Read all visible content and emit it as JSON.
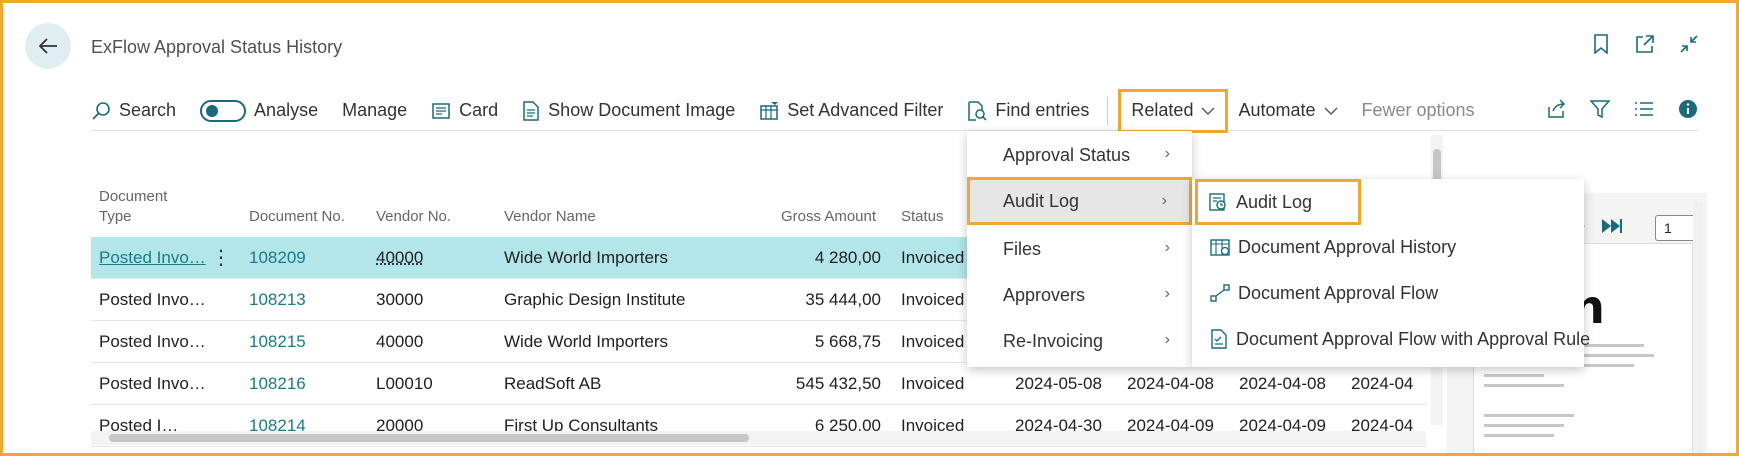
{
  "header": {
    "title": "ExFlow Approval Status History"
  },
  "actions": {
    "search": "Search",
    "analyse": "Analyse",
    "manage": "Manage",
    "card": "Card",
    "show_document_image": "Show Document Image",
    "set_advanced_filter": "Set Advanced Filter",
    "find_entries": "Find entries",
    "related": "Related",
    "automate": "Automate",
    "fewer_options": "Fewer options"
  },
  "table": {
    "headers": {
      "document_type_1": "Document",
      "document_type_2": "Type",
      "document_no": "Document No.",
      "vendor_no": "Vendor No.",
      "vendor_name": "Vendor Name",
      "gross_amount": "Gross Amount",
      "status": "Status"
    },
    "rows": [
      {
        "doc_type": "Posted Invo…",
        "doc_no": "108209",
        "vendor_no": "40000",
        "vendor_name": "Wide World Importers",
        "gross": "4 280,00",
        "status": "Invoiced",
        "d1": "",
        "d2": "",
        "d3": "",
        "d4": ""
      },
      {
        "doc_type": "Posted Invo…",
        "doc_no": "108213",
        "vendor_no": "30000",
        "vendor_name": "Graphic Design Institute",
        "gross": "35 444,00",
        "status": "Invoiced",
        "d1": "",
        "d2": "",
        "d3": "",
        "d4": ""
      },
      {
        "doc_type": "Posted Invo…",
        "doc_no": "108215",
        "vendor_no": "40000",
        "vendor_name": "Wide World Importers",
        "gross": "5 668,75",
        "status": "Invoiced",
        "d1": "",
        "d2": "",
        "d3": "",
        "d4": ""
      },
      {
        "doc_type": "Posted Invo…",
        "doc_no": "108216",
        "vendor_no": "L00010",
        "vendor_name": "ReadSoft AB",
        "gross": "545 432,50",
        "status": "Invoiced",
        "d1": "2024-05-08",
        "d2": "2024-04-08",
        "d3": "2024-04-08",
        "d4": "2024-04"
      },
      {
        "doc_type": "Posted I…",
        "doc_no": "108214",
        "vendor_no": "20000",
        "vendor_name": "First Up Consultants",
        "gross": "6 250,00",
        "status": "Invoiced",
        "d1": "2024-04-30",
        "d2": "2024-04-09",
        "d3": "2024-04-09",
        "d4": "2024-04"
      }
    ]
  },
  "related_menu": {
    "items": [
      {
        "label": "Approval Status"
      },
      {
        "label": "Audit Log"
      },
      {
        "label": "Files"
      },
      {
        "label": "Approvers"
      },
      {
        "label": "Re-Invoicing"
      }
    ]
  },
  "audit_submenu": {
    "items": [
      {
        "label": "Audit Log"
      },
      {
        "label": "Document Approval History"
      },
      {
        "label": "Document Approval Flow"
      },
      {
        "label": "Document Approval Flow with Approval Rule"
      }
    ]
  },
  "preview": {
    "page_number": "1",
    "logo_text": "stin"
  },
  "colors": {
    "accent": "#1a7a85",
    "highlight_border": "#f0a830",
    "selected_row": "#b3e6ea"
  }
}
